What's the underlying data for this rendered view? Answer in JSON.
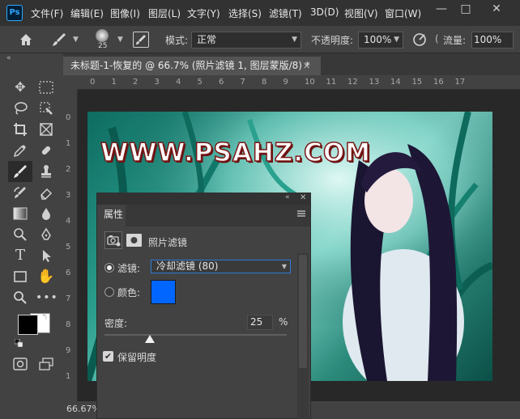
{
  "app": {
    "logo_text": "Ps"
  },
  "menu": [
    "文件(F)",
    "编辑(E)",
    "图像(I)",
    "图层(L)",
    "文字(Y)",
    "选择(S)",
    "滤镜(T)",
    "3D(D)",
    "视图(V)",
    "窗口(W)"
  ],
  "window_controls": {
    "minimize": "—",
    "maximize": "□",
    "close": "✕"
  },
  "options": {
    "brush_size": "25",
    "mode_label": "模式:",
    "mode_value": "正常",
    "opacity_label": "不透明度:",
    "opacity_value": "100%",
    "flow_label": "流量:",
    "flow_value": "100%"
  },
  "document": {
    "tab_title": "未标题-1-恢复的 @ 66.7% (照片滤镜 1, 图层蒙版/8) *",
    "zoom_status": "66.67%",
    "watermark": "WWW.PSAHZ.COM"
  },
  "rulers": {
    "top": [
      "0",
      "1",
      "2",
      "3",
      "4",
      "5",
      "6",
      "7",
      "8",
      "9",
      "10",
      "11",
      "12",
      "13",
      "14",
      "15",
      "16",
      "17"
    ],
    "left": [
      "0",
      "1",
      "2",
      "3",
      "4",
      "5",
      "6",
      "7",
      "8",
      "9",
      "1"
    ]
  },
  "properties_panel": {
    "tab_label": "属性",
    "adjustment_title": "照片滤镜",
    "filter_label": "滤镜:",
    "filter_value": "冷却滤镜 (80)",
    "color_label": "颜色:",
    "color_swatch": "#0066ff",
    "density_label": "密度:",
    "density_value": "25",
    "density_unit": "%",
    "density_fraction": 0.25,
    "preserve_label": "保留明度",
    "preserve_checked": true,
    "filter_mode_selected": "filter"
  },
  "colors": {
    "foreground": "#000000",
    "background": "#ffffff",
    "accent": "#31a8ff"
  }
}
